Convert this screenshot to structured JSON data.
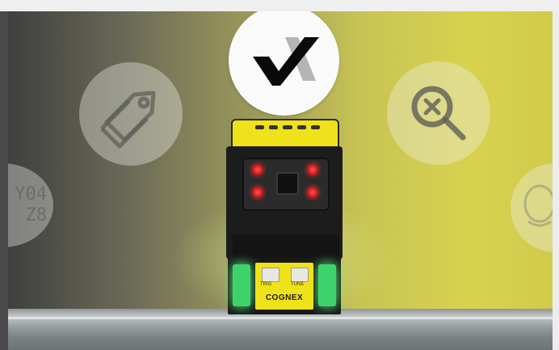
{
  "hero": {
    "icons": [
      {
        "icon": "checkmark-logo-icon"
      },
      {
        "icon": "tag-icon"
      },
      {
        "icon": "search-x-icon"
      },
      {
        "icon": "barcode-code-icon",
        "text": [
          "Y04",
          "Z8"
        ]
      },
      {
        "icon": "face-outline-icon"
      }
    ]
  },
  "camera": {
    "button_trig": "TRIG",
    "button_tune": "TUNE",
    "brand": "COGNEX"
  },
  "colors": {
    "device_yellow": "#f0e21a",
    "status_green": "#3ed36a",
    "led_red": "#e02020"
  }
}
